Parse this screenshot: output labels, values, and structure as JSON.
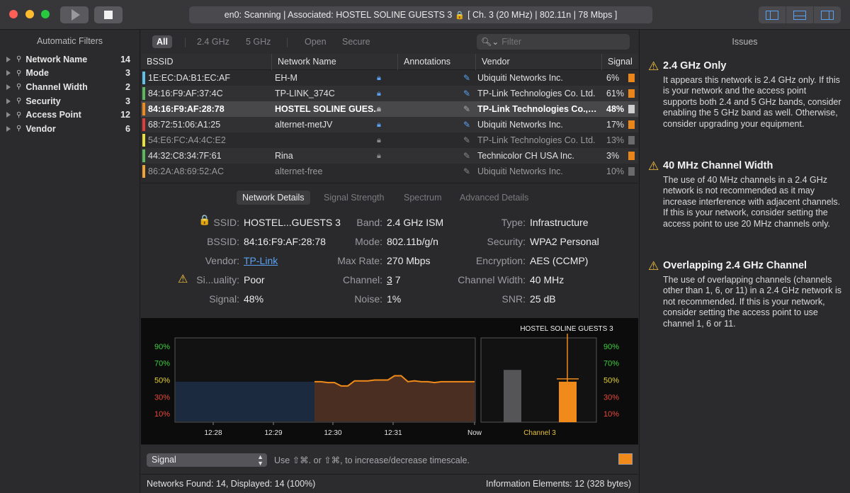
{
  "titlebar": {
    "status": "en0: Scanning  |  Associated: HOSTEL SOLINE GUESTS 3",
    "status_detail": "[ Ch. 3 (20 MHz) | 802.11n | 78 Mbps ]"
  },
  "sidebar": {
    "title": "Automatic Filters",
    "items": [
      {
        "label": "Network Name",
        "count": "14"
      },
      {
        "label": "Mode",
        "count": "3"
      },
      {
        "label": "Channel Width",
        "count": "2"
      },
      {
        "label": "Security",
        "count": "3"
      },
      {
        "label": "Access Point",
        "count": "12"
      },
      {
        "label": "Vendor",
        "count": "6"
      }
    ]
  },
  "toolbar": {
    "all": "All",
    "band24": "2.4 GHz",
    "band5": "5 GHz",
    "open": "Open",
    "secure": "Secure",
    "filter_placeholder": "Filter"
  },
  "table": {
    "headers": {
      "bssid": "BSSID",
      "name": "Network Name",
      "annotations": "Annotations",
      "vendor": "Vendor",
      "signal": "Signal"
    },
    "rows": [
      {
        "color": "#5fc0e8",
        "bssid": "1E:EC:DA:B1:EC:AF",
        "name": "EH-M",
        "vendor": "Ubiquiti Networks Inc.",
        "signal": "6%",
        "sigcolor": "#e8851b",
        "lock_color": "#5aa1f2",
        "ann_color": "#5aa1f2"
      },
      {
        "color": "#5cb85c",
        "bssid": "84:16:F9:AF:37:4C",
        "name": "TP-LINK_374C",
        "vendor": "TP-Link Technologies Co. Ltd.",
        "signal": "61%",
        "sigcolor": "#e8851b",
        "lock_color": "#5aa1f2",
        "ann_color": "#5aa1f2"
      },
      {
        "color": "#f08a1a",
        "bssid": "84:16:F9:AF:28:78",
        "name": "HOSTEL SOLINE GUES...",
        "vendor": "TP-Link Technologies Co.,Ltd.",
        "signal": "48%",
        "sigcolor": "#cfcfcf",
        "lock_color": "#a8a8ab",
        "ann_color": "#a8a8ab"
      },
      {
        "color": "#e23b3b",
        "bssid": "68:72:51:06:A1:25",
        "name": "alternet-metJV",
        "vendor": "Ubiquiti Networks Inc.",
        "signal": "17%",
        "sigcolor": "#e8851b",
        "lock_color": "#5aa1f2",
        "ann_color": "#5aa1f2"
      },
      {
        "color": "#e8e03a",
        "bssid": "54:E6:FC:A4:4C:E2",
        "name": "",
        "vendor": "TP-Link Technologies Co. Ltd.",
        "signal": "13%",
        "sigcolor": "#6a6a6d",
        "lock_color": "#8a8a8d",
        "ann_color": "#8a8a8d"
      },
      {
        "color": "#5cb85c",
        "bssid": "44:32:C8:34:7F:61",
        "name": "Rina",
        "vendor": "Technicolor CH USA Inc.",
        "signal": "3%",
        "sigcolor": "#e8851b",
        "lock_color": "#8a8a8d",
        "ann_color": "#8a8a8d"
      },
      {
        "color": "#f0a23a",
        "bssid": "86:2A:A8:69:52:AC",
        "name": "alternet-free",
        "vendor": "Ubiquiti Networks Inc.",
        "signal": "10%",
        "sigcolor": "#6a6a6d",
        "lock_color": "",
        "ann_color": "#8a8a8d"
      }
    ]
  },
  "detail_tabs": [
    "Network Details",
    "Signal Strength",
    "Spectrum",
    "Advanced Details"
  ],
  "details": {
    "ssid_label": "SSID:",
    "ssid": "HOSTEL...GUESTS 3",
    "bssid_label": "BSSID:",
    "bssid": "84:16:F9:AF:28:78",
    "vendor_label": "Vendor:",
    "vendor": "TP-Link",
    "quality_label": "Si...uality:",
    "quality": "Poor",
    "signal_label": "Signal:",
    "signal": "48%",
    "band_label": "Band:",
    "band": "2.4 GHz ISM",
    "mode_label": "Mode:",
    "mode": "802.11b/g/n",
    "maxrate_label": "Max Rate:",
    "maxrate": "270 Mbps",
    "channel_label": "Channel:",
    "channel_primary": "3",
    "channel_secondary": "7",
    "noise_label": "Noise:",
    "noise": "1%",
    "type_label": "Type:",
    "type": "Infrastructure",
    "security_label": "Security:",
    "security": "WPA2 Personal",
    "encryption_label": "Encryption:",
    "encryption": "AES (CCMP)",
    "width_label": "Channel Width:",
    "width": "40 MHz",
    "snr_label": "SNR:",
    "snr": "25 dB"
  },
  "graph": {
    "ytick_labels": [
      "90%",
      "70%",
      "50%",
      "30%",
      "10%"
    ],
    "ytick_values": [
      90,
      70,
      50,
      30,
      10
    ],
    "ytick_colors": [
      "#3fce3f",
      "#3fce3f",
      "#e6d23a",
      "#e84a3a",
      "#e84a3a"
    ],
    "xtick_labels": [
      "12:28",
      "12:29",
      "12:30",
      "12:31",
      "Now"
    ],
    "signal_series": [
      48,
      48,
      47,
      47,
      43,
      43,
      49,
      49,
      49,
      50,
      50,
      50,
      55,
      55,
      48,
      49,
      48,
      48,
      47,
      48,
      48,
      48,
      48,
      48,
      48
    ],
    "right_title": "HOSTEL SOLINE GUESTS 3",
    "right_label": "Channel 3",
    "bar_other": 62,
    "bar_current": 48
  },
  "controls": {
    "select": "Signal",
    "hint": "Use ⇧⌘. or ⇧⌘, to increase/decrease timescale."
  },
  "footer": {
    "left": "Networks Found: 14, Displayed: 14 (100%)",
    "right": "Information Elements: 12 (328 bytes)"
  },
  "issues": {
    "title": "Issues",
    "items": [
      {
        "title": "2.4 GHz Only",
        "body": "It appears this network is 2.4 GHz only. If this is your network and the access point supports both 2.4 and 5 GHz bands, consider enabling the 5 GHz band as well. Otherwise, consider upgrading your equipment."
      },
      {
        "title": "40 MHz Channel Width",
        "body": "The use of 40 MHz channels in a 2.4 GHz network is not recommended as it may increase interference with adjacent channels. If this is your network, consider setting the access point to use 20 MHz channels only."
      },
      {
        "title": "Overlapping 2.4 GHz Channel",
        "body": "The use of overlapping channels (channels other than 1, 6, or 11) in a 2.4 GHz network is not recommended. If this is your network, consider setting the access point to use channel 1, 6 or 11."
      }
    ]
  }
}
